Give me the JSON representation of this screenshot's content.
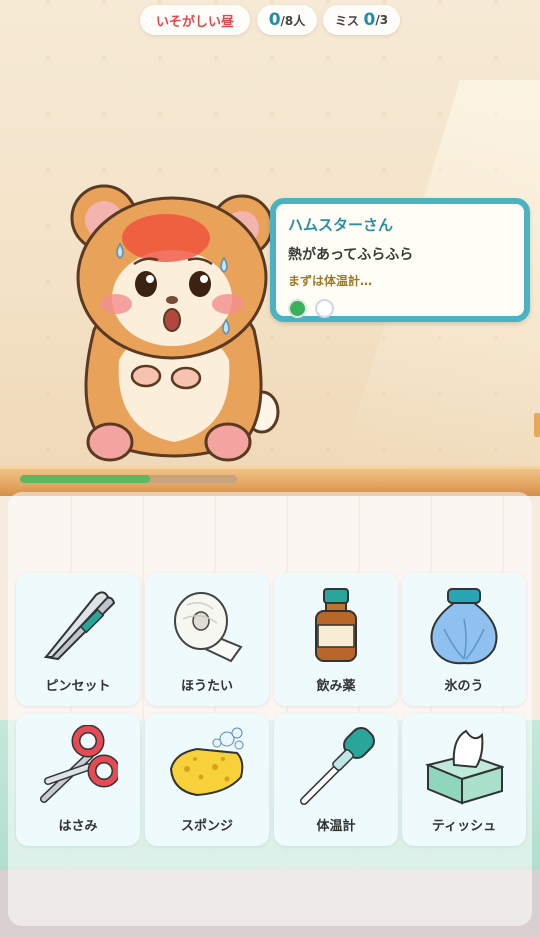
{
  "hud": {
    "time_label": "いそがしい昼",
    "score_value": "0",
    "score_suffix": "/8人",
    "miss_label": "ミス",
    "miss_value": "0",
    "miss_suffix": "/3"
  },
  "patient": {
    "name": "ハムスターさん",
    "symptom": "熱があってふらふら",
    "hint": "まずは体温計…",
    "steps_total": 2,
    "steps_done": 1
  },
  "progress": {
    "fraction": 0.6
  },
  "tools": [
    {
      "label": "ピンセット",
      "icon": "tweezers-icon"
    },
    {
      "label": "ほうたい",
      "icon": "bandage-icon"
    },
    {
      "label": "飲み薬",
      "icon": "medicine-bottle-icon"
    },
    {
      "label": "氷のう",
      "icon": "ice-bag-icon"
    },
    {
      "label": "はさみ",
      "icon": "scissors-icon"
    },
    {
      "label": "スポンジ",
      "icon": "sponge-icon"
    },
    {
      "label": "体温計",
      "icon": "thermometer-icon"
    },
    {
      "label": "ティッシュ",
      "icon": "tissue-box-icon"
    }
  ],
  "colors": {
    "accent": "#4ab3c2",
    "time_text": "#e4474f",
    "progress": "#5bb860",
    "step_done": "#3bb05c"
  }
}
